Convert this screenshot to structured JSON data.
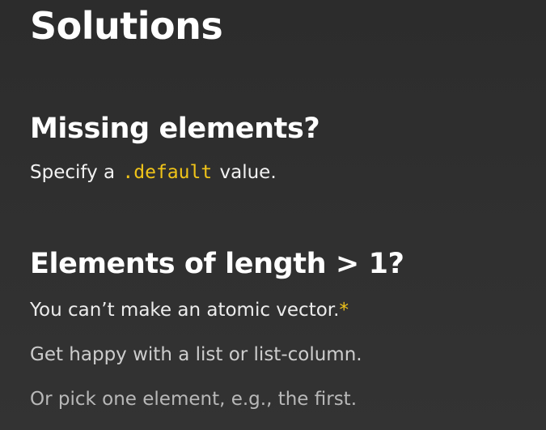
{
  "slide": {
    "title": "Solutions",
    "sections": [
      {
        "heading": "Missing elements?",
        "line": {
          "before": "Specify a ",
          "code": ".default",
          "after": " value."
        }
      },
      {
        "heading": "Elements of length > 1?",
        "lines": [
          {
            "text": "You can’t make an atomic vector.",
            "marker": "*"
          },
          {
            "text": "Get happy with a list or list-column."
          },
          {
            "text": "Or pick one element, e.g., the first."
          }
        ]
      }
    ]
  },
  "colors": {
    "background": "#313131",
    "text": "#ffffff",
    "accent": "#f0c419"
  }
}
